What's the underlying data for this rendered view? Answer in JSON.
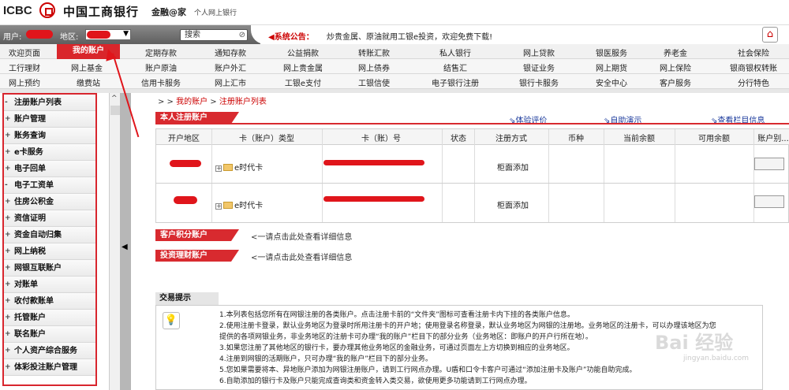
{
  "header": {
    "logo_text": "ICBC",
    "brand_cn": "中国工商银行",
    "brand_sub": "金融@家",
    "brand_sub2": "个人网上银行"
  },
  "userbar": {
    "user_label": "用户:",
    "area_label": "地区:",
    "search_placeholder": "搜索",
    "search_icon": "search-icon"
  },
  "notice": {
    "title": "◀系统公告：",
    "message": "炒贵金属、原油就用工银e投资，欢迎免费下载!"
  },
  "nav": {
    "row1": [
      "欢迎页面",
      "我的账户",
      "定期存款",
      "通知存款",
      "公益捐款",
      "转账汇款",
      "私人银行",
      "网上贷款",
      "银医服务",
      "养老金",
      "社会保险"
    ],
    "row2": [
      "工行理财",
      "网上基金",
      "账户原油",
      "账户外汇",
      "网上贵金属",
      "网上债券",
      "结售汇",
      "银证业务",
      "网上期货",
      "网上保险",
      "银商银权转账"
    ],
    "row3": [
      "网上预约",
      "缴费站",
      "信用卡服务",
      "网上汇市",
      "工银e支付",
      "工银信使",
      "电子银行注册",
      "银行卡服务",
      "安全中心",
      "客户服务",
      "分行特色"
    ],
    "active": "我的账户"
  },
  "sidebar": {
    "items": [
      "注册账户列表",
      "账户管理",
      "账务查询",
      "e卡服务",
      "电子回单",
      "电子工资单",
      "住房公积金",
      "资信证明",
      "资金自动归集",
      "网上纳税",
      "网银互联账户",
      "对账单",
      "收付款账单",
      "托管账户",
      "联名账户",
      "个人资产综合服务",
      "体彩投注账户管理"
    ],
    "first_marker": "-",
    "marker": "+"
  },
  "breadcrumb": {
    "prefix": "> > ",
    "parts": [
      "我的账户",
      "注册账户列表"
    ],
    "sep": " > "
  },
  "main": {
    "panel_title": "本人注册账户",
    "links": [
      "体验评价",
      "自助演示",
      "查看栏目信息"
    ],
    "columns": [
      "开户地区",
      "卡（账户）类型",
      "卡（账）号",
      "状态",
      "注册方式",
      "币种",
      "当前余额",
      "可用余额",
      "账户别..."
    ],
    "rows": [
      {
        "card_type": "e时代卡",
        "method": "柜面添加"
      },
      {
        "card_type": "e时代卡",
        "method": "柜面添加"
      }
    ],
    "sections": [
      {
        "title": "客户积分账户",
        "link": "<一请点击此处查看详细信息"
      },
      {
        "title": "投资理财账户",
        "link": "<一请点击此处查看详细信息"
      }
    ]
  },
  "tips": {
    "title": "交易提示",
    "lines": [
      "1.本列表包括您所有在网银注册的各类账户。点击注册卡前的“文件夹”图标可查看注册卡内下挂的各类账户信息。",
      "2.使用注册卡登录，默认业务地区为登录时所用注册卡的开户地；使用登录名称登录，默认业务地区为网银的注册地。业务地区的注册卡，可以办理该地区为您",
      "提供的各项网银业务，非业务地区的注册卡可办理“我的账户”栏目下的部分业务（业务地区：即账户的开户行所在地）。",
      "3.如果您注册了其他地区的银行卡，要办理其他业务地区的金融业务，可通过页面左上方切换到相应的业务地区。",
      "4.注册到网银的活期账户，只可办理“我的账户”栏目下的部分业务。",
      "5.您如果需要将本、异地账户添加为网银注册账户，请到工行网点办理。U盾和口令卡客户可通过“添加注册卡及账户”功能自助完成。",
      "6.自助添加的银行卡及账户只能完成查询类和资金转入类交易，欲使用更多功能请到工行网点办理。"
    ]
  },
  "watermark": {
    "text": "Bai 经验",
    "sub": "jingyan.baidu.com"
  },
  "colors": {
    "accent": "#d82a2f",
    "link": "#1b3a9c",
    "annotation": "#e0151b"
  }
}
